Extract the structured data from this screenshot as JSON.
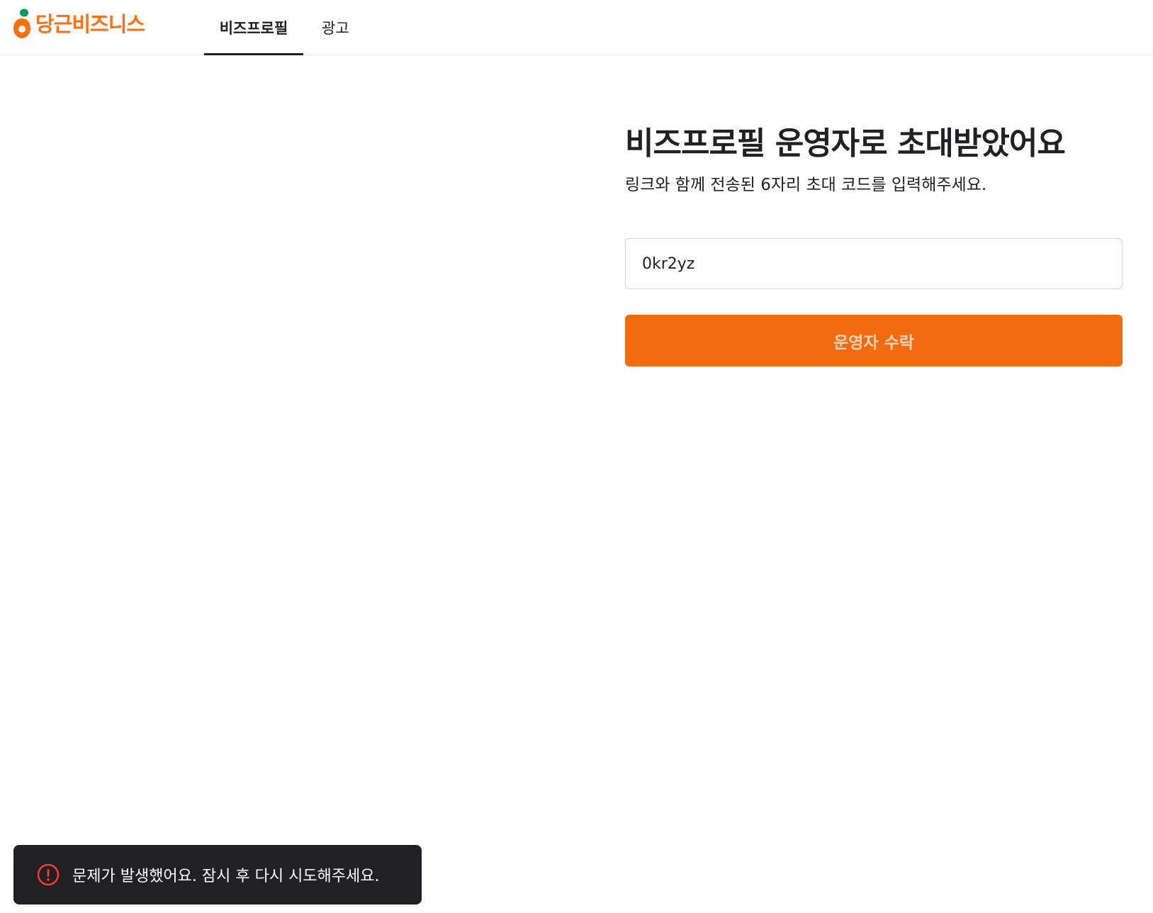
{
  "header": {
    "logo_text": "당근비즈니스",
    "brand_color": "#ff6f0f",
    "tabs": [
      {
        "label": "비즈프로필",
        "active": true
      },
      {
        "label": "광고",
        "active": false
      }
    ]
  },
  "invite": {
    "title": "비즈프로필 운영자로 초대받았어요",
    "subtitle": "링크와 함께 전송된 6자리 초대 코드를 입력해주세요.",
    "code_value": "0kr2yz",
    "accept_button_label": "운영자 수락",
    "accent_color": "#f26b0f"
  },
  "toast": {
    "icon": "error-icon",
    "message": "문제가 발생했어요. 잠시 후 다시 시도해주세요.",
    "icon_color": "#ff3b30"
  }
}
